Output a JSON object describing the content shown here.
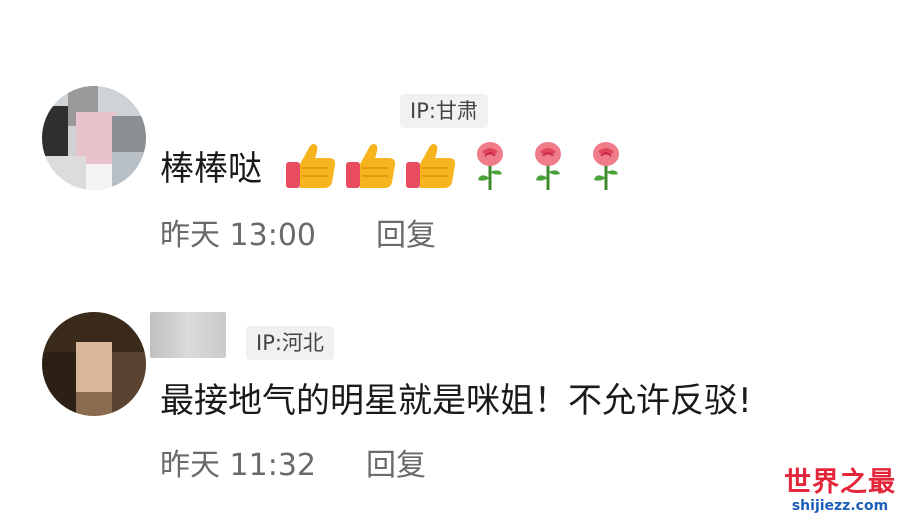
{
  "comments": [
    {
      "ip_label": "IP:甘肃",
      "text": "棒棒哒",
      "emojis": [
        "thumbs-up-icon",
        "thumbs-up-icon",
        "thumbs-up-icon",
        "rose-icon",
        "rose-icon",
        "rose-icon"
      ],
      "time": "昨天 13:00",
      "reply_label": "回复"
    },
    {
      "ip_label": "IP:河北",
      "text": "最接地气的明星就是咪姐！不允许反驳!",
      "time": "昨天 11:32",
      "reply_label": "回复"
    }
  ],
  "watermark": {
    "title": "世界之最",
    "url": "shijiezz.com"
  },
  "colors": {
    "accent_red": "#e3263a",
    "watermark_blue": "#1d5fb8",
    "meta_gray": "#6a6a6a",
    "badge_bg": "#f1f1f1"
  }
}
